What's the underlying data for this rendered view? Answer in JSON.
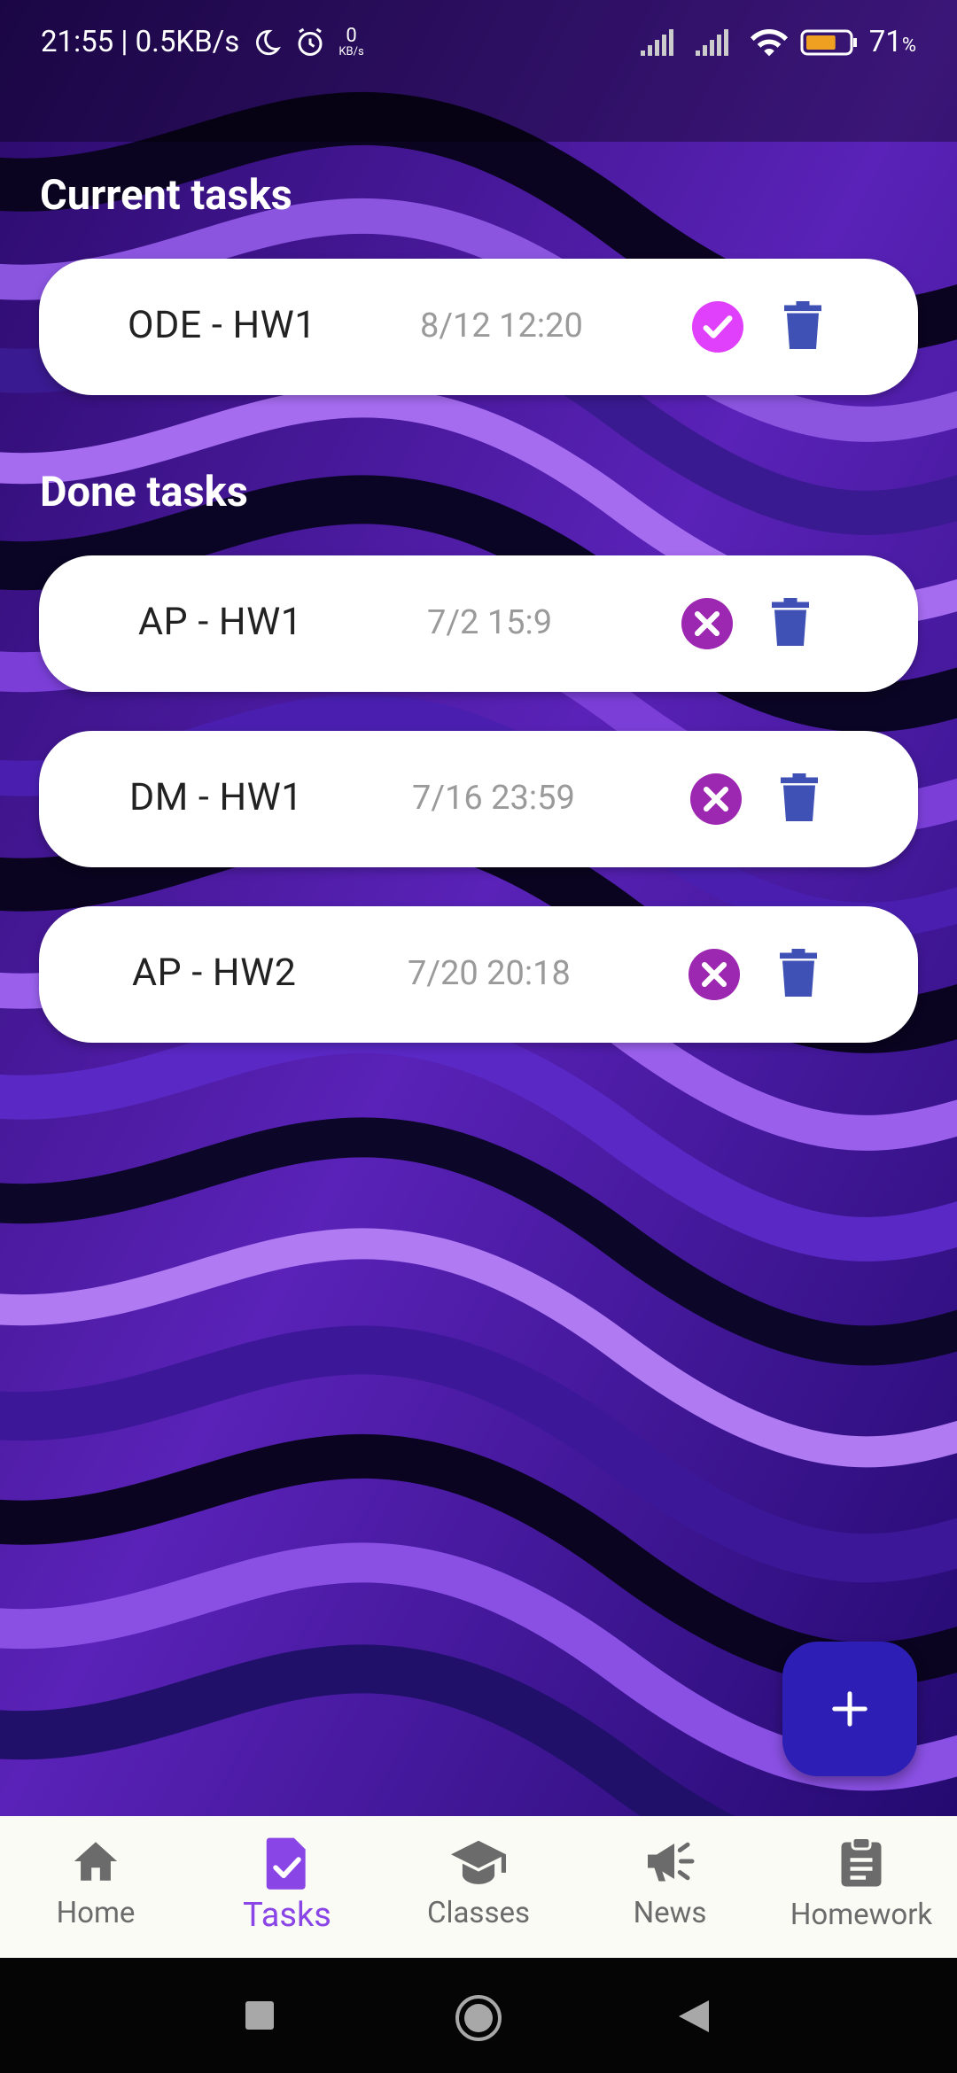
{
  "status_bar": {
    "time_speed": "21:55 | 0.5KB/s",
    "net_value": "0",
    "net_unit": "KB/s",
    "battery": "71",
    "battery_unit": "%",
    "battery_level": 0.71
  },
  "sections": {
    "current_title": "Current tasks",
    "done_title": "Done tasks"
  },
  "current_tasks": [
    {
      "name": "ODE - HW1",
      "date": "8/12 12:20",
      "status_icon": "check-circle-icon"
    }
  ],
  "done_tasks": [
    {
      "name": "AP - HW1",
      "date": "7/2 15:9",
      "status_icon": "close-circle-icon"
    },
    {
      "name": "DM - HW1",
      "date": "7/16 23:59",
      "status_icon": "close-circle-icon"
    },
    {
      "name": "AP - HW2",
      "date": "7/20 20:18",
      "status_icon": "close-circle-icon"
    }
  ],
  "fab": {
    "icon": "plus-icon"
  },
  "nav": [
    {
      "label": "Home",
      "icon": "home-icon",
      "active": false
    },
    {
      "label": "Tasks",
      "icon": "task-check-icon",
      "active": true
    },
    {
      "label": "Classes",
      "icon": "graduation-cap-icon",
      "active": false
    },
    {
      "label": "News",
      "icon": "megaphone-icon",
      "active": false
    },
    {
      "label": "Homework",
      "icon": "clipboard-icon",
      "active": false
    }
  ],
  "colors": {
    "check_accent": "#e040fb",
    "cross_accent": "#9c27b0",
    "trash": "#3f51b5",
    "fab": "#2d1fb6",
    "nav_active": "#8a45e6"
  }
}
